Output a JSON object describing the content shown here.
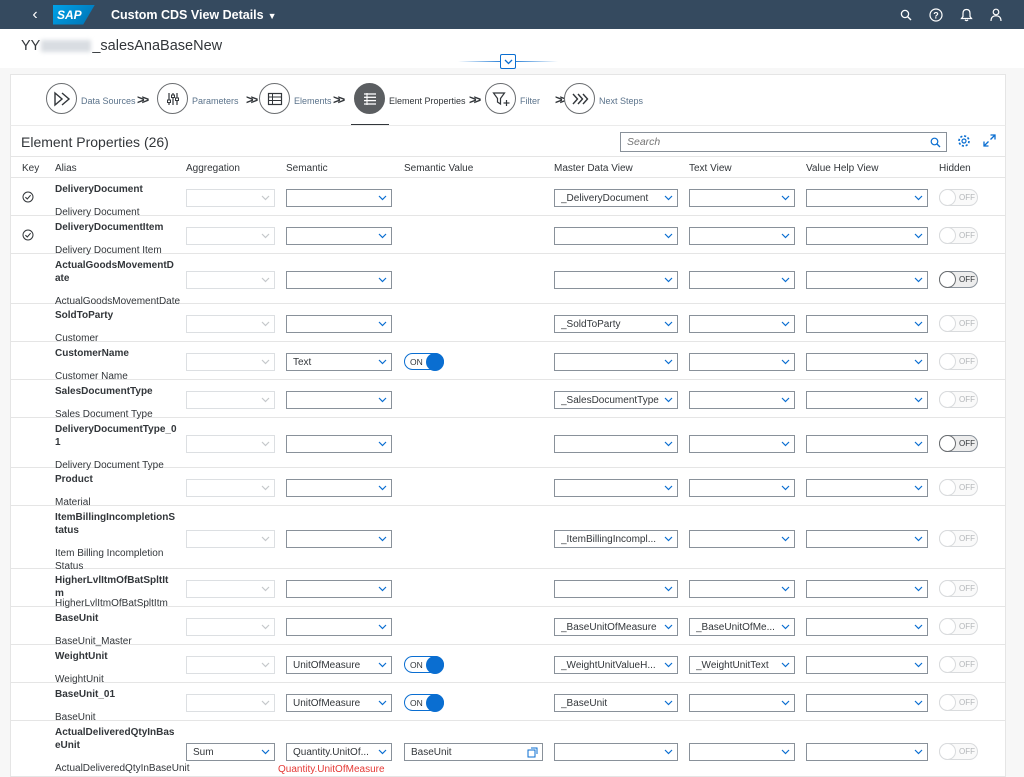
{
  "shell": {
    "app_title": "Custom CDS View Details",
    "logo_text": "SAP"
  },
  "header": {
    "title_prefix": "YY",
    "title_suffix": "_salesAnaBaseNew"
  },
  "steps": [
    {
      "label": "Data Sources",
      "icon": "data-sources-icon"
    },
    {
      "label": "Parameters",
      "icon": "parameters-icon"
    },
    {
      "label": "Elements",
      "icon": "elements-icon"
    },
    {
      "label": "Element Properties",
      "icon": "element-properties-icon",
      "active": true
    },
    {
      "label": "Filter",
      "icon": "filter-add-icon"
    },
    {
      "label": "Next Steps",
      "icon": "next-steps-icon"
    }
  ],
  "table": {
    "title": "Element Properties (26)",
    "search_placeholder": "Search",
    "columns": [
      "Key",
      "Alias",
      "Aggregation",
      "Semantic",
      "Semantic Value",
      "Master Data View",
      "Text View",
      "Value Help View",
      "Hidden"
    ],
    "on_label": "ON",
    "off_label": "OFF",
    "rows": [
      {
        "alias": "DeliveryDocument",
        "desc": "Delivery Document",
        "key": true,
        "aggregation": "",
        "semantic": "",
        "semantic_value": "",
        "master": "_DeliveryDocument",
        "text": "",
        "valuehelp": "",
        "hidden": "off-disabled"
      },
      {
        "alias": "DeliveryDocumentItem",
        "desc": "Delivery Document Item",
        "key": true,
        "aggregation": "",
        "semantic": "",
        "semantic_value": "",
        "master": "",
        "text": "",
        "valuehelp": "",
        "hidden": "off-disabled"
      },
      {
        "alias": "ActualGoodsMovementDate",
        "desc": "ActualGoodsMovementDate",
        "key": false,
        "aggregation": "",
        "semantic": "",
        "semantic_value": "",
        "master": "",
        "text": "",
        "valuehelp": "",
        "hidden": "off"
      },
      {
        "alias": "SoldToParty",
        "desc": "Customer",
        "key": false,
        "aggregation": "",
        "semantic": "",
        "semantic_value": "",
        "master": "_SoldToParty",
        "text": "",
        "valuehelp": "",
        "hidden": "off-disabled"
      },
      {
        "alias": "CustomerName",
        "desc": "Customer Name",
        "key": false,
        "aggregation": "",
        "semantic": "Text",
        "semantic_value": "on",
        "master": "",
        "text": "",
        "valuehelp": "",
        "hidden": "off-disabled"
      },
      {
        "alias": "SalesDocumentType",
        "desc": "Sales Document Type",
        "key": false,
        "aggregation": "",
        "semantic": "",
        "semantic_value": "",
        "master": "_SalesDocumentType",
        "text": "",
        "valuehelp": "",
        "hidden": "off-disabled"
      },
      {
        "alias": "DeliveryDocumentType_01",
        "desc": "Delivery Document Type",
        "key": false,
        "aggregation": "",
        "semantic": "",
        "semantic_value": "",
        "master": "",
        "text": "",
        "valuehelp": "",
        "hidden": "off"
      },
      {
        "alias": "Product",
        "desc": "Material",
        "key": false,
        "aggregation": "",
        "semantic": "",
        "semantic_value": "",
        "master": "",
        "text": "",
        "valuehelp": "",
        "hidden": "off-disabled"
      },
      {
        "alias": "ItemBillingIncompletionStatus",
        "desc": "Item Billing Incompletion Status",
        "key": false,
        "aggregation": "",
        "semantic": "",
        "semantic_value": "",
        "master": "_ItemBillingIncompl...",
        "text": "",
        "valuehelp": "",
        "hidden": "off-disabled"
      },
      {
        "alias": "HigherLvlItmOfBatSpltItm",
        "desc": "HigherLvlItmOfBatSpltItm",
        "key": false,
        "aggregation": "",
        "semantic": "",
        "semantic_value": "",
        "master": "",
        "text": "",
        "valuehelp": "",
        "hidden": "off-disabled"
      },
      {
        "alias": "BaseUnit",
        "desc": "BaseUnit_Master",
        "key": false,
        "aggregation": "",
        "semantic": "",
        "semantic_value": "",
        "master": "_BaseUnitOfMeasure",
        "text": "_BaseUnitOfMe...",
        "valuehelp": "",
        "hidden": "off-disabled"
      },
      {
        "alias": "WeightUnit",
        "desc": "WeightUnit",
        "key": false,
        "aggregation": "",
        "semantic": "UnitOfMeasure",
        "semantic_value": "on",
        "master": "_WeightUnitValueH...",
        "text": "_WeightUnitText",
        "valuehelp": "",
        "hidden": "off-disabled"
      },
      {
        "alias": "BaseUnit_01",
        "desc": "BaseUnit",
        "key": false,
        "aggregation": "",
        "semantic": "UnitOfMeasure",
        "semantic_value": "on",
        "master": "_BaseUnit",
        "text": "",
        "valuehelp": "",
        "hidden": "off-disabled"
      },
      {
        "alias": "ActualDeliveredQtyInBaseUnit",
        "desc": "ActualDeliveredQtyInBaseUnit",
        "key": false,
        "aggregation": "Sum",
        "semantic": "Quantity.UnitOf...",
        "semantic_value": "BaseUnit",
        "semantic_error": "Quantity.UnitOfMeasure",
        "master": "",
        "text": "",
        "valuehelp": "",
        "hidden": "off-disabled"
      }
    ]
  },
  "colors": {
    "shell_bg": "#354a5f",
    "accent": "#0a6ed1",
    "error": "#e53935"
  }
}
